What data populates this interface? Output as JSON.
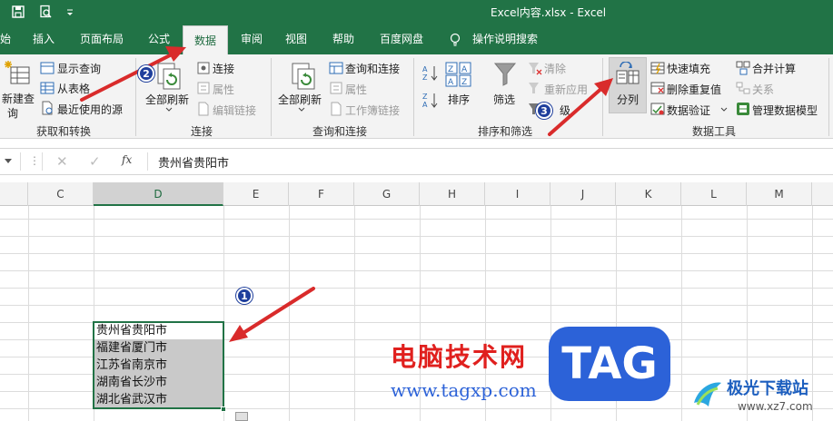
{
  "window": {
    "title": "Excel内容.xlsx - Excel"
  },
  "menu": {
    "tabs": [
      "始",
      "插入",
      "页面布局",
      "公式",
      "数据",
      "审阅",
      "视图",
      "帮助",
      "百度网盘"
    ],
    "active_tab": "数据",
    "tell_me": "操作说明搜索"
  },
  "ribbon": {
    "get_transform": {
      "new_query": "新建查",
      "new_query_2": "询",
      "show_queries": "显示查询",
      "from_table": "从表格",
      "recent_sources": "最近使用的源",
      "group": "获取和转换"
    },
    "connections": {
      "refresh_all": "全部刷新",
      "connections": "连接",
      "properties": "属性",
      "edit_links": "编辑链接",
      "group": "连接"
    },
    "queries": {
      "refresh_all": "全部刷新",
      "queries_connections": "查询和连接",
      "properties": "属性",
      "workbook_links": "工作簿链接",
      "group": "查询和连接"
    },
    "sort_filter": {
      "sort": "排序",
      "filter": "筛选",
      "clear": "清除",
      "reapply": "重新应用",
      "advanced": "级",
      "group": "排序和筛选"
    },
    "data_tools": {
      "text_to_columns": "分列",
      "flash_fill": "快速填充",
      "remove_duplicates": "删除重复值",
      "data_validation": "数据验证",
      "consolidate": "合并计算",
      "relationships": "关系",
      "data_model": "管理数据模型",
      "group": "数据工具"
    }
  },
  "formula_bar": {
    "fx": "fx",
    "content": "贵州省贵阳市"
  },
  "columns": [
    "C",
    "D",
    "E",
    "F",
    "G",
    "H",
    "I",
    "J",
    "K",
    "L",
    "M"
  ],
  "cells": [
    "贵州省贵阳市",
    "福建省厦门市",
    "江苏省南京市",
    "湖南省长沙市",
    "湖北省武汉市"
  ],
  "badges": [
    "1",
    "2",
    "3"
  ],
  "watermark": {
    "brand": "电脑技术网",
    "url": "www.tagxp.com",
    "logo": "TAG",
    "site2": "极光下载站",
    "url2": "www.xz7.com"
  },
  "colors": {
    "excel_green": "#217346",
    "badge_blue": "#1f3f9c",
    "arrow_red": "#d92b2b",
    "watermark_red": "#e0201e",
    "logo_blue": "#2c62d8"
  }
}
